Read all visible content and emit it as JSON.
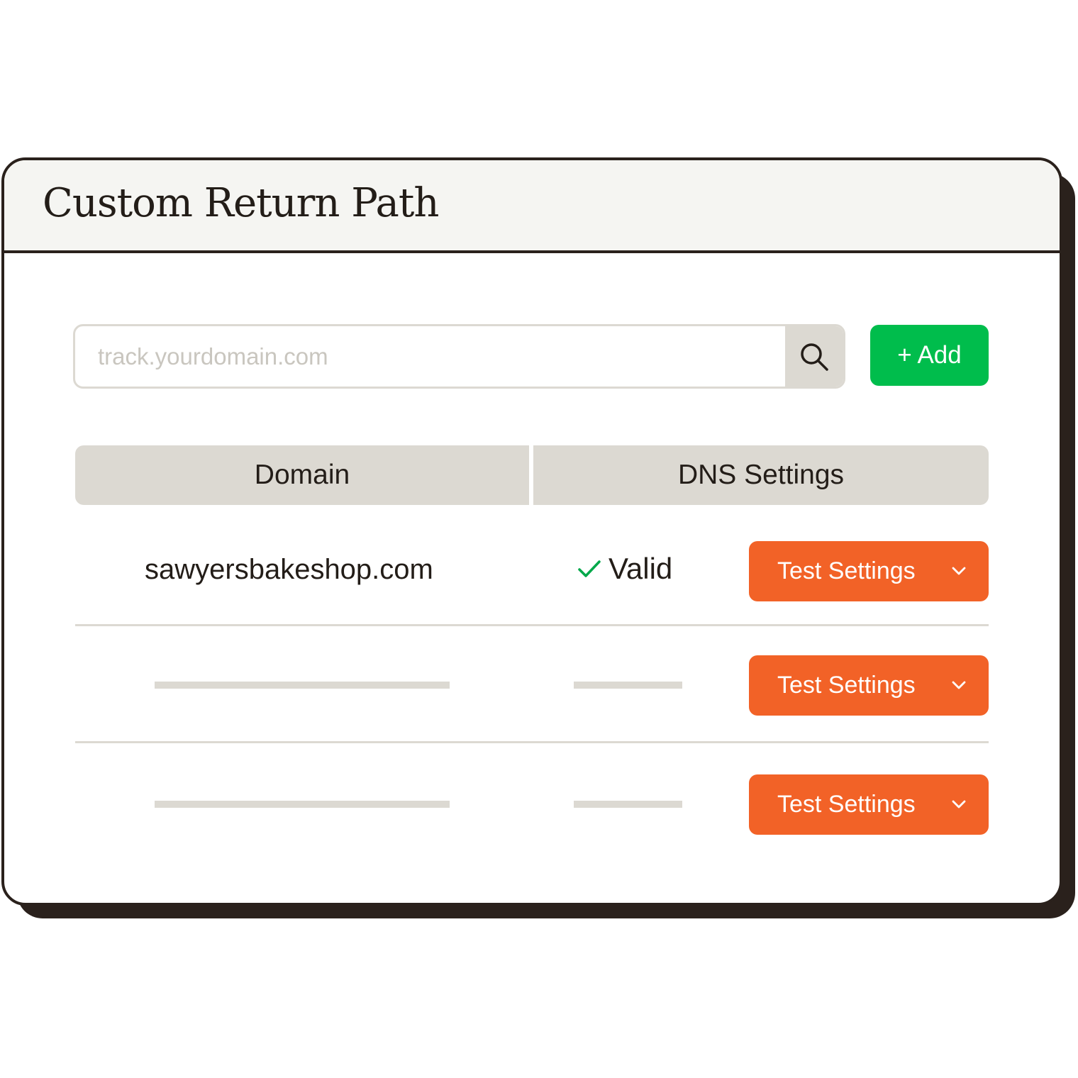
{
  "window": {
    "title": "Custom Return Path"
  },
  "search": {
    "placeholder": "track.yourdomain.com",
    "icon": "search-icon"
  },
  "toolbar": {
    "add_label": "+ Add"
  },
  "table": {
    "columns": [
      "Domain",
      "DNS Settings"
    ],
    "rows": [
      {
        "domain": "sawyersbakeshop.com",
        "status": "Valid",
        "action_label": "Test Settings"
      },
      {
        "domain": "",
        "status": "",
        "action_label": "Test Settings"
      },
      {
        "domain": "",
        "status": "",
        "action_label": "Test Settings"
      }
    ]
  },
  "colors": {
    "add_green": "#00bd4c",
    "action_orange": "#f26227",
    "valid_check": "#00a84a",
    "border_dark": "#2a211c",
    "header_gray": "#dcd9d2"
  }
}
